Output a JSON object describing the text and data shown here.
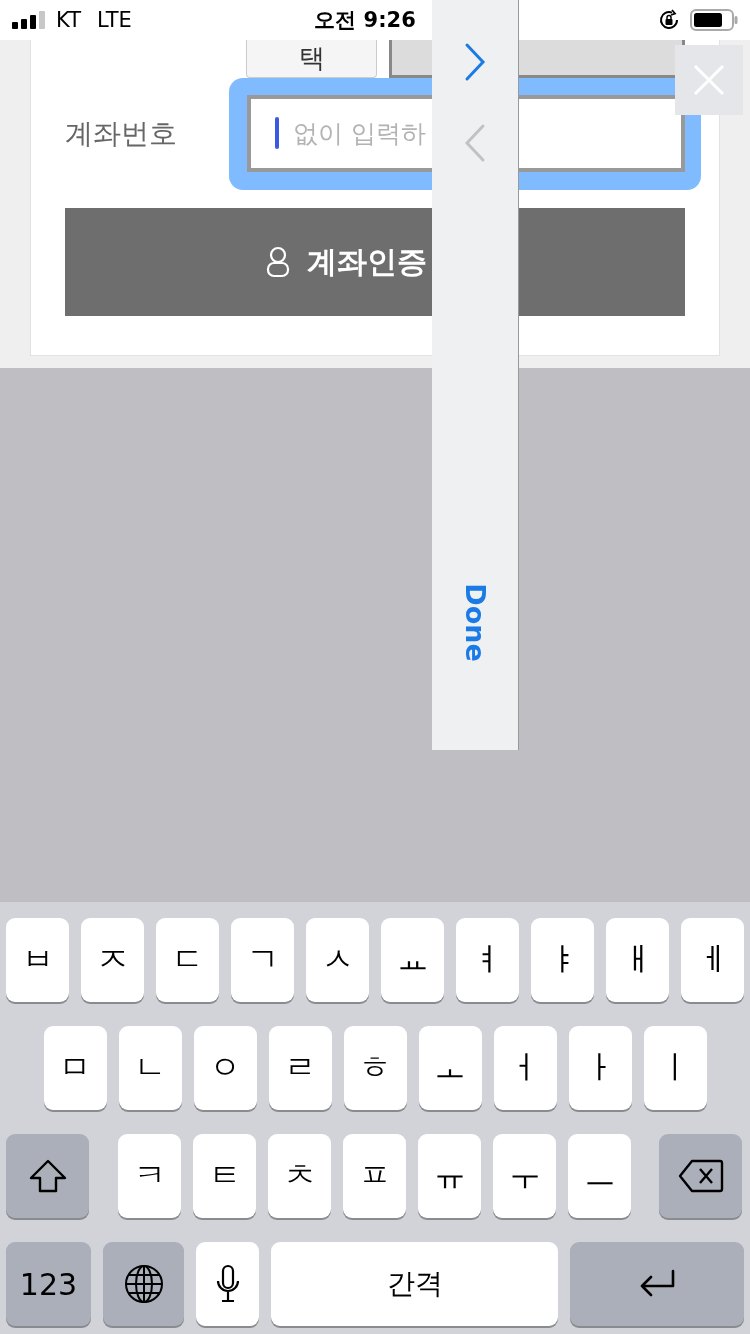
{
  "status_bar": {
    "carrier": "KT",
    "network": "LTE",
    "time": "오전 9:26"
  },
  "form": {
    "bank_button": "택",
    "account_number_label": "계좌번호",
    "account_number_field": {
      "placeholder": "없이 입력하",
      "focused": true
    },
    "verify_button": "계좌인증"
  },
  "toolbar": {
    "next": {
      "disabled": false
    },
    "previous": {
      "disabled": true
    },
    "done": "Done"
  },
  "keyboard": {
    "rows": [
      [
        {
          "kind": "letter",
          "label": "ㅂ"
        },
        {
          "kind": "letter",
          "label": "ㅈ"
        },
        {
          "kind": "letter",
          "label": "ㄷ"
        },
        {
          "kind": "letter",
          "label": "ㄱ"
        },
        {
          "kind": "letter",
          "label": "ㅅ"
        },
        {
          "kind": "letter",
          "label": "ㅛ"
        },
        {
          "kind": "letter",
          "label": "ㅕ"
        },
        {
          "kind": "letter",
          "label": "ㅑ"
        },
        {
          "kind": "letter",
          "label": "ㅐ"
        },
        {
          "kind": "letter",
          "label": "ㅔ"
        }
      ],
      [
        {
          "kind": "letter",
          "label": "ㅁ"
        },
        {
          "kind": "letter",
          "label": "ㄴ"
        },
        {
          "kind": "letter",
          "label": "ㅇ"
        },
        {
          "kind": "letter",
          "label": "ㄹ"
        },
        {
          "kind": "letter",
          "label": "ㅎ"
        },
        {
          "kind": "letter",
          "label": "ㅗ"
        },
        {
          "kind": "letter",
          "label": "ㅓ"
        },
        {
          "kind": "letter",
          "label": "ㅏ"
        },
        {
          "kind": "letter",
          "label": "ㅣ"
        }
      ],
      [
        {
          "kind": "shift"
        },
        {
          "kind": "letter",
          "label": "ㅋ"
        },
        {
          "kind": "letter",
          "label": "ㅌ"
        },
        {
          "kind": "letter",
          "label": "ㅊ"
        },
        {
          "kind": "letter",
          "label": "ㅍ"
        },
        {
          "kind": "letter",
          "label": "ㅠ"
        },
        {
          "kind": "letter",
          "label": "ㅜ"
        },
        {
          "kind": "letter",
          "label": "ㅡ"
        },
        {
          "kind": "backspace"
        }
      ],
      [
        {
          "kind": "numbers",
          "label": "123"
        },
        {
          "kind": "globe"
        },
        {
          "kind": "mic"
        },
        {
          "kind": "space",
          "label": "간격"
        },
        {
          "kind": "return"
        }
      ]
    ]
  }
}
